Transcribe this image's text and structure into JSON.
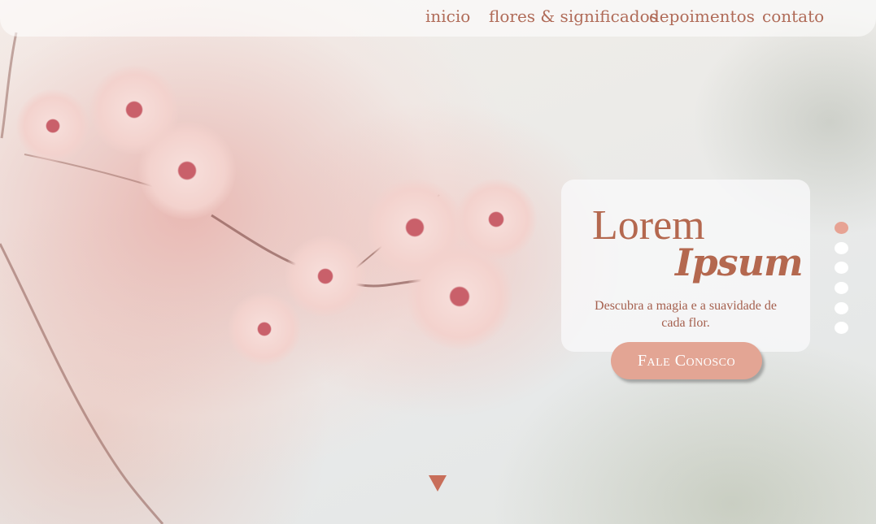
{
  "nav": {
    "items": [
      {
        "label": "inicio"
      },
      {
        "label": "flores & significados"
      },
      {
        "label": "depoimentos"
      },
      {
        "label": "contato"
      }
    ]
  },
  "hero": {
    "title_line1": "Lorem",
    "title_line2": "Ipsum",
    "tagline": "Descubra a magia e a suavidade de cada flor.",
    "cta_label": "Fale Conosco"
  },
  "carousel": {
    "slide_count": 6,
    "active_index": 0
  },
  "scroll_icon": "triangle-down-icon",
  "colors": {
    "accent": "#b4684f",
    "button": "#e3a594",
    "active_dot": "#e7a394",
    "inactive_dot": "#ffffff"
  }
}
